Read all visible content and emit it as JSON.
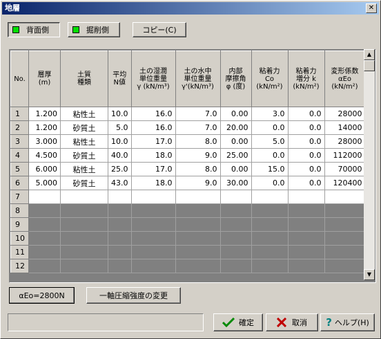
{
  "window": {
    "title": "地層",
    "close_glyph": "✕"
  },
  "toolbar": {
    "back_label": "背面側",
    "cut_label": "掘削側",
    "copy_label": "コピー(C)"
  },
  "grid": {
    "headers": [
      [
        "No."
      ],
      [
        "層厚",
        "(m)"
      ],
      [
        "土質",
        "種類"
      ],
      [
        "平均",
        "N値"
      ],
      [
        "土の湿潤",
        "単位重量",
        "γ (kN/m³)"
      ],
      [
        "土の水中",
        "単位重量",
        "γ'(kN/m³)"
      ],
      [
        "内部",
        "摩擦角",
        "φ (度)"
      ],
      [
        "粘着力",
        "Co",
        "(kN/m²)"
      ],
      [
        "粘着力",
        "増分 k",
        "(kN/m²)"
      ],
      [
        "変形係数",
        "αEo",
        "(kN/m²)"
      ]
    ],
    "rows": [
      {
        "no": "1",
        "thickness": "1.200",
        "soil": "粘性土",
        "n": "10.0",
        "wet": "16.0",
        "sub": "7.0",
        "phi": "0.00",
        "co": "3.0",
        "k": "0.0",
        "aeo": "28000"
      },
      {
        "no": "2",
        "thickness": "1.200",
        "soil": "砂質土",
        "n": "5.0",
        "wet": "16.0",
        "sub": "7.0",
        "phi": "20.00",
        "co": "0.0",
        "k": "0.0",
        "aeo": "14000"
      },
      {
        "no": "3",
        "thickness": "3.000",
        "soil": "粘性土",
        "n": "10.0",
        "wet": "17.0",
        "sub": "8.0",
        "phi": "0.00",
        "co": "5.0",
        "k": "0.0",
        "aeo": "28000"
      },
      {
        "no": "4",
        "thickness": "4.500",
        "soil": "砂質土",
        "n": "40.0",
        "wet": "18.0",
        "sub": "9.0",
        "phi": "25.00",
        "co": "0.0",
        "k": "0.0",
        "aeo": "112000"
      },
      {
        "no": "5",
        "thickness": "6.000",
        "soil": "粘性土",
        "n": "25.0",
        "wet": "17.0",
        "sub": "8.0",
        "phi": "0.00",
        "co": "15.0",
        "k": "0.0",
        "aeo": "70000"
      },
      {
        "no": "6",
        "thickness": "5.000",
        "soil": "砂質土",
        "n": "43.0",
        "wet": "18.0",
        "sub": "9.0",
        "phi": "30.00",
        "co": "0.0",
        "k": "0.0",
        "aeo": "120400"
      }
    ],
    "empty_rows": [
      "7"
    ],
    "gray_rows": [
      "8",
      "9",
      "10",
      "11",
      "12"
    ]
  },
  "bottom": {
    "aeo_label": "αEo=2800N",
    "uniaxial_label": "一軸圧縮強度の変更",
    "ok_label": "確定",
    "cancel_label": "取消",
    "help_label": "ヘルプ(H)"
  },
  "icons": {
    "ok": "check-icon",
    "cancel": "x-icon",
    "help": "question-icon"
  },
  "colors": {
    "ok": "#0a8a0a",
    "cancel": "#c00000",
    "help": "#008080",
    "indicator": "#00e000"
  }
}
